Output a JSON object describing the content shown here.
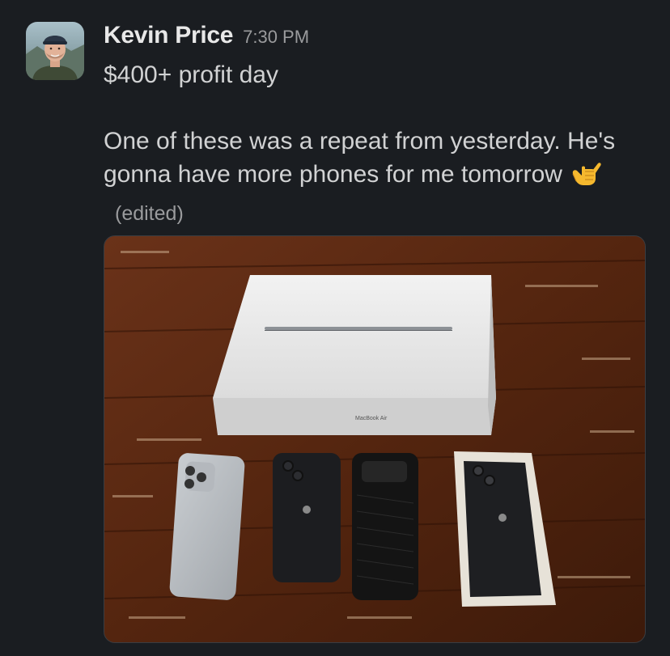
{
  "message": {
    "sender": "Kevin Price",
    "timestamp": "7:30 PM",
    "line1": "$400+ profit day",
    "paragraph2": "One of these was a repeat from yesterday. He's gonna have more phones for me tomorrow",
    "emoji": "call-me-hand-emoji",
    "edited_label": "(edited)"
  },
  "attachment": {
    "type": "photo",
    "box_label": "MacBook Air"
  },
  "colors": {
    "background": "#1a1d21",
    "text": "#d1d2d3",
    "muted": "#9a9b9d",
    "sender": "#e8e8e8"
  }
}
